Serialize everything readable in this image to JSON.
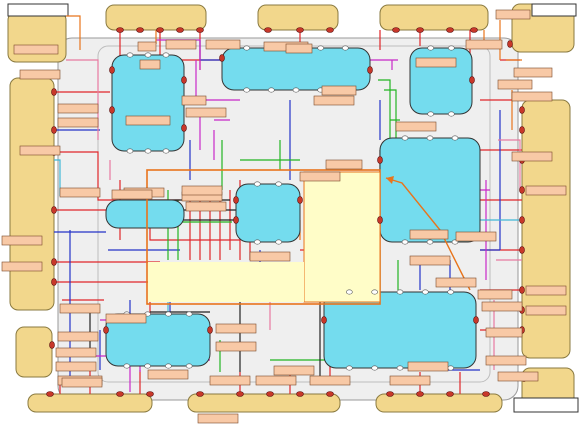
{
  "colors": {
    "background": "#ffffff",
    "board": "#efefef",
    "board_border": "#9a9a9a",
    "connector": "#f2d78c",
    "connector_border": "#8a7a40",
    "component": "#74dcee",
    "component_border": "#333333",
    "pin": "#c8382a",
    "pin_border": "#5a1010",
    "net_label": "#f8c9a6",
    "net_label_border": "#7a4a2a",
    "selection": "#e8741c",
    "tooltip": "#fffdc8",
    "wire_red": "#e0262a",
    "wire_blue": "#2433c8",
    "wire_green": "#22b422",
    "wire_magenta": "#c828c8",
    "wire_orange": "#e8741c",
    "wire_cyan": "#40b8d8",
    "wire_black": "#222222",
    "wire_pink": "#e87aa0"
  },
  "tooltip": {
    "text": "",
    "icon": "info-popup"
  },
  "corner_labels": {
    "top_left": "",
    "top_right": "",
    "bottom_right": ""
  }
}
